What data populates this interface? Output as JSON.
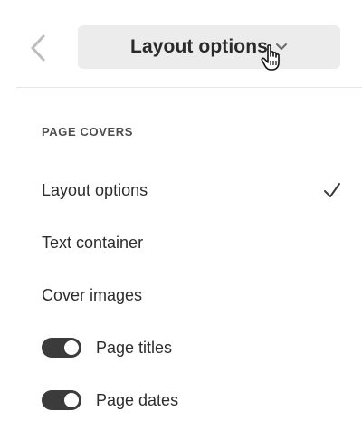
{
  "header": {
    "back_icon": "chevron-left-icon",
    "dropdown_label": "Layout options",
    "dropdown_icon": "chevron-down-icon"
  },
  "menu": {
    "section_heading": "PAGE COVERS",
    "items": [
      {
        "label": "Layout options",
        "selected": true
      },
      {
        "label": "Text container",
        "selected": false
      },
      {
        "label": "Cover images",
        "selected": false
      }
    ],
    "toggles": [
      {
        "label": "Page titles",
        "on": true
      },
      {
        "label": "Page dates",
        "on": true
      }
    ]
  },
  "colors": {
    "dropdown_bg": "#ececec",
    "toggle_on": "#3b3b3b",
    "text": "#2c2c2c"
  }
}
